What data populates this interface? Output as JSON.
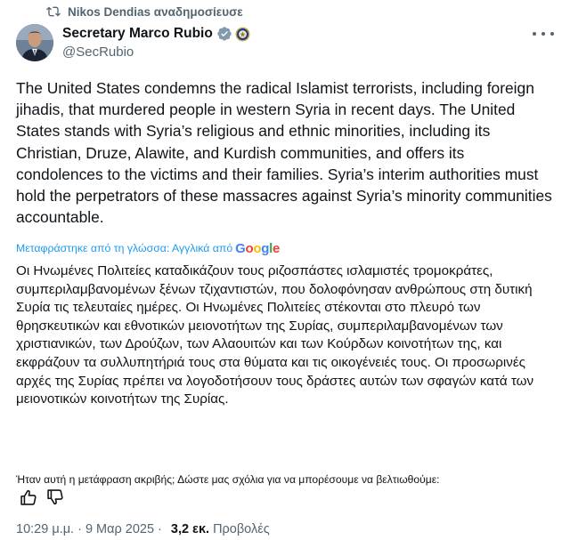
{
  "retweet": {
    "label": "Nikos Dendias αναδημοσίευσε",
    "icon": "retweet-icon"
  },
  "author": {
    "display_name": "Secretary Marco Rubio",
    "handle": "@SecRubio",
    "verified_icon": "verified-badge-icon",
    "affiliation_icon": "government-seal-icon",
    "verified_color": "#1d9bf0"
  },
  "more_icon": "more-options-icon",
  "tweet": {
    "text": "The United States condemns the radical Islamist terrorists, including foreign jihadis, that murdered people in western Syria in recent days. The United States stands with Syria’s religious and ethnic minorities, including its Christian, Druze, Alawite, and Kurdish communities, and offers its condolences to the victims and their families. Syria’s interim authorities must hold the perpetrators of these massacres against Syria’s minority communities accountable."
  },
  "translation": {
    "attribution": "Μεταφράστηκε από τη γλώσσα: Αγγλικά από",
    "provider": "Google",
    "text": "Οι Ηνωμένες Πολιτείες καταδικάζουν τους ριζοσπάστες ισλαμιστές τρομοκράτες, συμπεριλαμβανομένων ξένων τζιχαντιστών, που δολοφόνησαν ανθρώπους στη δυτική Συρία τις τελευταίες ημέρες. Οι Ηνωμένες Πολιτείες στέκονται στο πλευρό των θρησκευτικών και εθνοτικών μειονοτήτων της Συρίας, συμπεριλαμβανομένων των χριστιανικών, των Δρούζων, των Αλαουιτών και των Κούρδων κοινοτήτων της, και εκφράζουν τα συλλυπητήριά τους στα θύματα και τις οικογένειές τους. Οι προσωρινές αρχές της Συρίας πρέπει να λογοδοτήσουν τους δράστες αυτών των σφαγών κατά των μειονοτικών κοινοτήτων της Συρίας.",
    "feedback_prompt": "Ήταν αυτή η μετάφραση ακριβής; Δώστε μας σχόλια για να μπορέσουμε να βελτιωθούμε:",
    "thumbs_up_icon": "thumbs-up-icon",
    "thumbs_down_icon": "thumbs-down-icon"
  },
  "meta": {
    "time": "10:29 μ.μ.",
    "separator": "·",
    "date": "9 Μαρ 2025",
    "views_count": "3,2 εκ.",
    "views_label": "Προβολές"
  }
}
